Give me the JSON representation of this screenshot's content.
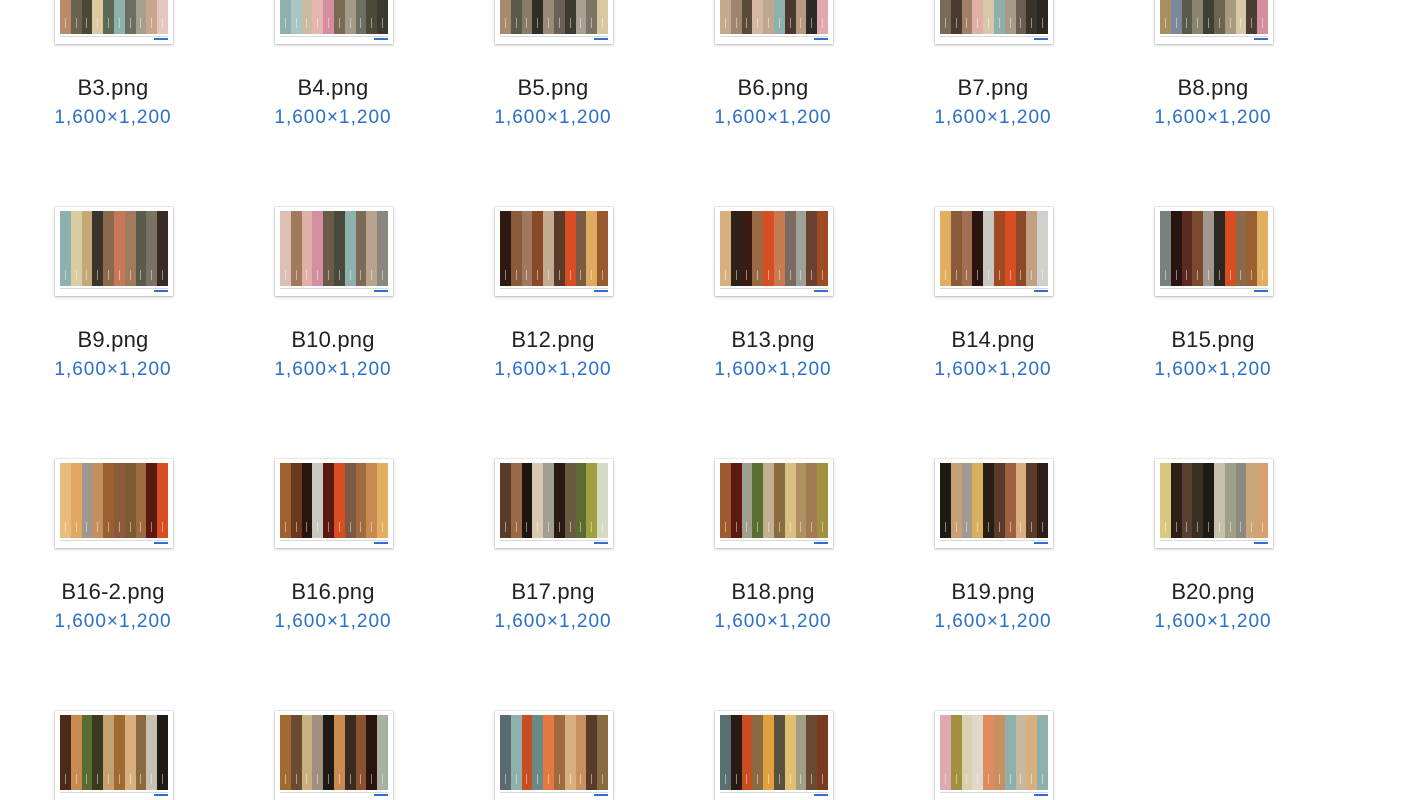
{
  "colors": {
    "name_text": "#222222",
    "size_text": "#2a6fc9",
    "background": "#ffffff"
  },
  "files": [
    {
      "name": "B3.png",
      "size": "1,600×1,200",
      "swatches": [
        "#b88a6a",
        "#6b6250",
        "#4b4838",
        "#dcc9a0",
        "#5c6a55",
        "#8fb1ad",
        "#6b6f5f",
        "#a3a08e",
        "#c9a58e",
        "#e2c8bf"
      ]
    },
    {
      "name": "B4.png",
      "size": "1,600×1,200",
      "swatches": [
        "#8fb1ad",
        "#a9c7c2",
        "#cbbba3",
        "#e3b7b0",
        "#d48ea0",
        "#7a6a55",
        "#a39a8a",
        "#6b7060",
        "#4a4a3a",
        "#3a3a2e"
      ]
    },
    {
      "name": "B5.png",
      "size": "1,600×1,200",
      "swatches": [
        "#a88a6c",
        "#5a5a4a",
        "#8a7a68",
        "#2e2e26",
        "#9a8a78",
        "#6a6058",
        "#3e3a32",
        "#a8a090",
        "#7e7466",
        "#d8c8a0"
      ]
    },
    {
      "name": "B6.png",
      "size": "1,600×1,200",
      "swatches": [
        "#c4aa8c",
        "#a08470",
        "#5a4a3a",
        "#d4b8a0",
        "#c0a890",
        "#8fb1ad",
        "#4a3a2e",
        "#b89880",
        "#2e2a26",
        "#e2a8b0"
      ]
    },
    {
      "name": "B7.png",
      "size": "1,600×1,200",
      "swatches": [
        "#7a6a58",
        "#4a3a2e",
        "#a08068",
        "#e0b0a8",
        "#d8c8a8",
        "#8fb1ad",
        "#a89a88",
        "#6a5e50",
        "#3a3228",
        "#2a2622"
      ]
    },
    {
      "name": "B8.png",
      "size": "1,600×1,200",
      "swatches": [
        "#a89060",
        "#7a8a9a",
        "#5a5a48",
        "#8a8470",
        "#3e4034",
        "#6a6450",
        "#a89a80",
        "#d8c8a8",
        "#4a3e34",
        "#d48ea0"
      ]
    },
    {
      "name": "B9.png",
      "size": "1,600×1,200",
      "swatches": [
        "#8fb1ad",
        "#d8cda5",
        "#c4a878",
        "#3a342a",
        "#8a6a4a",
        "#c8775a",
        "#a07a5a",
        "#5a5a48",
        "#7a7264",
        "#3a2a24"
      ]
    },
    {
      "name": "B10.png",
      "size": "1,600×1,200",
      "swatches": [
        "#dcc0b4",
        "#a07a5a",
        "#e0b0a8",
        "#d48ea0",
        "#6a5a48",
        "#4a4a3a",
        "#8fb1ad",
        "#7a6a58",
        "#b8a48c",
        "#8a8680"
      ]
    },
    {
      "name": "B12.png",
      "size": "1,600×1,200",
      "swatches": [
        "#2e1a12",
        "#8a5a3a",
        "#a07860",
        "#8a4a2a",
        "#c4aa90",
        "#5a3a28",
        "#d84e22",
        "#7a5a40",
        "#e0a860",
        "#9a5a30"
      ]
    },
    {
      "name": "B13.png",
      "size": "1,600×1,200",
      "swatches": [
        "#d8b080",
        "#2e2218",
        "#3a1a12",
        "#9a6a44",
        "#d84e22",
        "#c87a50",
        "#7a6a60",
        "#a0a098",
        "#6a4030",
        "#a04a24"
      ]
    },
    {
      "name": "B14.png",
      "size": "1,600×1,200",
      "swatches": [
        "#e0b060",
        "#8a5a3a",
        "#a07050",
        "#2a1410",
        "#c8c8c0",
        "#a04a24",
        "#d84e22",
        "#8a4a2a",
        "#c0a080",
        "#d0d0cc"
      ]
    },
    {
      "name": "B15.png",
      "size": "1,600×1,200",
      "swatches": [
        "#7a8080",
        "#2a1410",
        "#5a2a20",
        "#7a4a2a",
        "#a09890",
        "#2e2620",
        "#d84e22",
        "#8a6a4a",
        "#9a6030",
        "#e0b060"
      ]
    },
    {
      "name": "B16-2.png",
      "size": "1,600×1,200",
      "swatches": [
        "#e8bc80",
        "#e0a860",
        "#a09890",
        "#c49060",
        "#9a6030",
        "#8a5a3a",
        "#7a5a30",
        "#a06a40",
        "#5a1a10",
        "#d84e22"
      ]
    },
    {
      "name": "B16.png",
      "size": "1,600×1,200",
      "swatches": [
        "#a06030",
        "#6a3a20",
        "#2a1410",
        "#c8c8c0",
        "#5a1a10",
        "#d84e22",
        "#7a5a40",
        "#a06a40",
        "#c88a50",
        "#e0b060"
      ]
    },
    {
      "name": "B17.png",
      "size": "1,600×1,200",
      "swatches": [
        "#5a3a28",
        "#9a6a44",
        "#1e1410",
        "#d8c8b0",
        "#a0a090",
        "#2a1a12",
        "#6a5a44",
        "#5a6a30",
        "#a0a040",
        "#d8d8c8"
      ]
    },
    {
      "name": "B18.png",
      "size": "1,600×1,200",
      "swatches": [
        "#a05a30",
        "#5a1a10",
        "#a0a090",
        "#5a7030",
        "#c0b090",
        "#8a6a40",
        "#d8c080",
        "#b09060",
        "#a07a50",
        "#a09040"
      ]
    },
    {
      "name": "B19.png",
      "size": "1,600×1,200",
      "swatches": [
        "#1e1a14",
        "#c8a078",
        "#a09a90",
        "#d8b060",
        "#2a1e14",
        "#5a3a28",
        "#a06040",
        "#d8b080",
        "#5a3a28",
        "#2e2018"
      ]
    },
    {
      "name": "B20.png",
      "size": "1,600×1,200",
      "swatches": [
        "#d8c880",
        "#2e2018",
        "#5a4030",
        "#3a3022",
        "#1e1a14",
        "#c8c0a8",
        "#a0a088",
        "#8a8a80",
        "#c8a878",
        "#d8a070"
      ]
    },
    {
      "name": "",
      "size": "",
      "swatches": [
        "#4a2a18",
        "#c88a50",
        "#5a6a30",
        "#3a3a20",
        "#c8a070",
        "#a06a30",
        "#d8b080",
        "#8a6a40",
        "#c8c0b0",
        "#1e1a14"
      ]
    },
    {
      "name": "",
      "size": "",
      "swatches": [
        "#a06a30",
        "#6a4a30",
        "#c8b080",
        "#a09080",
        "#1e1a14",
        "#c88a50",
        "#3a2a20",
        "#8a5030",
        "#2a1410",
        "#a8b0a0"
      ]
    },
    {
      "name": "",
      "size": "",
      "swatches": [
        "#5a6a70",
        "#8fb1ad",
        "#c84e22",
        "#6a8a88",
        "#e07a40",
        "#a06a40",
        "#d8b080",
        "#c89060",
        "#5a3a28",
        "#8a6a40"
      ]
    },
    {
      "name": "",
      "size": "",
      "swatches": [
        "#5a7070",
        "#2a1a14",
        "#c84e22",
        "#8a6a40",
        "#e0a040",
        "#5a5040",
        "#e0c070",
        "#a0a088",
        "#6a4a30",
        "#7a3a20"
      ]
    },
    {
      "name": "",
      "size": "",
      "swatches": [
        "#e0a8b0",
        "#a09040",
        "#d8d0b0",
        "#e0d8c8",
        "#e08a60",
        "#c89060",
        "#8fb1ad",
        "#c8b8a0",
        "#d8b080",
        "#8fb1ad"
      ]
    }
  ]
}
